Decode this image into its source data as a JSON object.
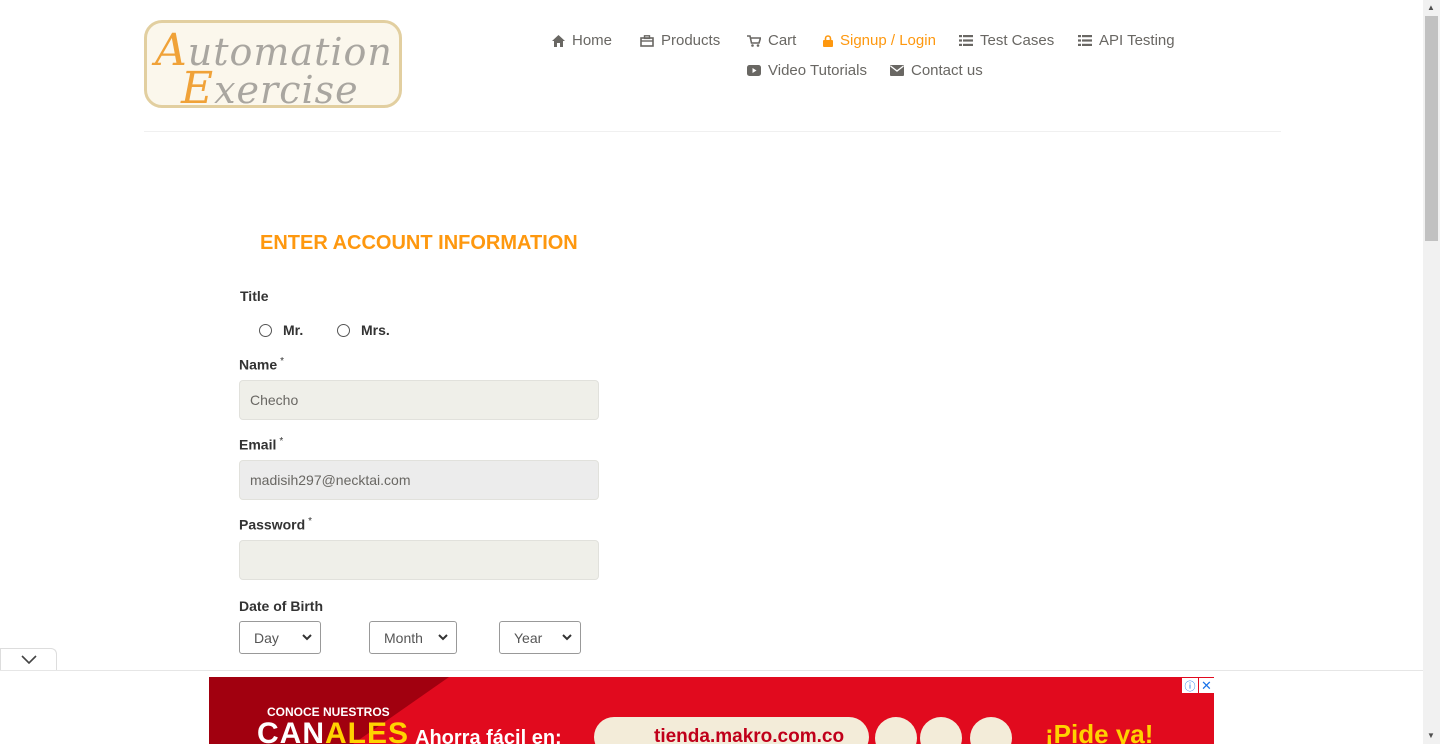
{
  "logo": {
    "line1_cap": "A",
    "line1_rest": "utomation",
    "line2_cap": "E",
    "line2_rest": "xercise"
  },
  "nav": [
    {
      "label": "Home",
      "icon": "home-icon"
    },
    {
      "label": "Products",
      "icon": "products-icon"
    },
    {
      "label": "Cart",
      "icon": "cart-icon"
    },
    {
      "label": "Signup / Login",
      "icon": "lock-icon",
      "active": true
    },
    {
      "label": "Test Cases",
      "icon": "list-icon"
    },
    {
      "label": "API Testing",
      "icon": "list-icon"
    },
    {
      "label": "Video Tutorials",
      "icon": "youtube-icon"
    },
    {
      "label": "Contact us",
      "icon": "envelope-icon"
    }
  ],
  "colors": {
    "accent": "#fe980f",
    "nav_text": "#696763",
    "ad_red": "#e10a1e"
  },
  "form": {
    "heading": "ENTER ACCOUNT INFORMATION",
    "title_label": "Title",
    "title_options": [
      "Mr.",
      "Mrs."
    ],
    "name_label": "Name",
    "name_value": "Checho",
    "email_label": "Email",
    "email_value": "madisih297@necktai.com",
    "password_label": "Password",
    "password_value": "",
    "required_mark": "*",
    "dob_label": "Date of Birth",
    "dob_day": "Day",
    "dob_month": "Month",
    "dob_year": "Year"
  },
  "ad": {
    "kicker": "CONOCE NUESTROS",
    "brand_white": "CAN",
    "brand_yellow": "ALES",
    "tagline": "Ahorra fácil en:",
    "url": "tienda.makro.com.co",
    "cta": "¡Pide ya!",
    "info": "ⓘ",
    "close": "✕"
  }
}
